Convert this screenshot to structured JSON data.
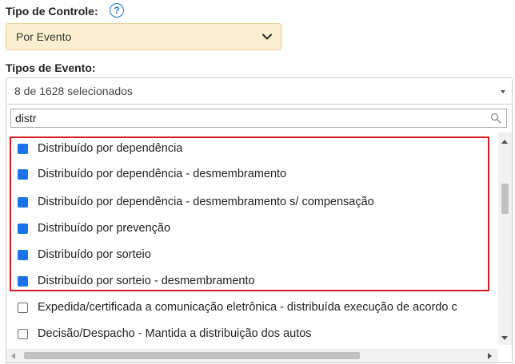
{
  "tipo_controle": {
    "label": "Tipo de Controle:",
    "help_icon": "question-circle-icon",
    "value": "Por Evento"
  },
  "tipos_evento": {
    "label": "Tipos de Evento:",
    "summary": "8 de 1628 selecionados",
    "search_value": "distr",
    "items": [
      {
        "label": "Distribuído por dependência",
        "checked": true
      },
      {
        "label": "Distribuído por dependência - desmembramento",
        "checked": true
      },
      {
        "label": "Distribuído por dependência - desmembramento s/ compensação",
        "checked": true
      },
      {
        "label": "Distribuído por prevenção",
        "checked": true
      },
      {
        "label": "Distribuído por sorteio",
        "checked": true
      },
      {
        "label": "Distribuído por sorteio - desmembramento",
        "checked": true
      },
      {
        "label": "Expedida/certificada a comunicação eletrônica - distribuída execução de acordo c",
        "checked": false
      },
      {
        "label": "Decisão/Despacho - Mantida a distribuição dos autos",
        "checked": false
      }
    ]
  },
  "colors": {
    "accent": "#1a73e8",
    "select_bg": "#fbefcf",
    "highlight_border": "#d71920"
  }
}
